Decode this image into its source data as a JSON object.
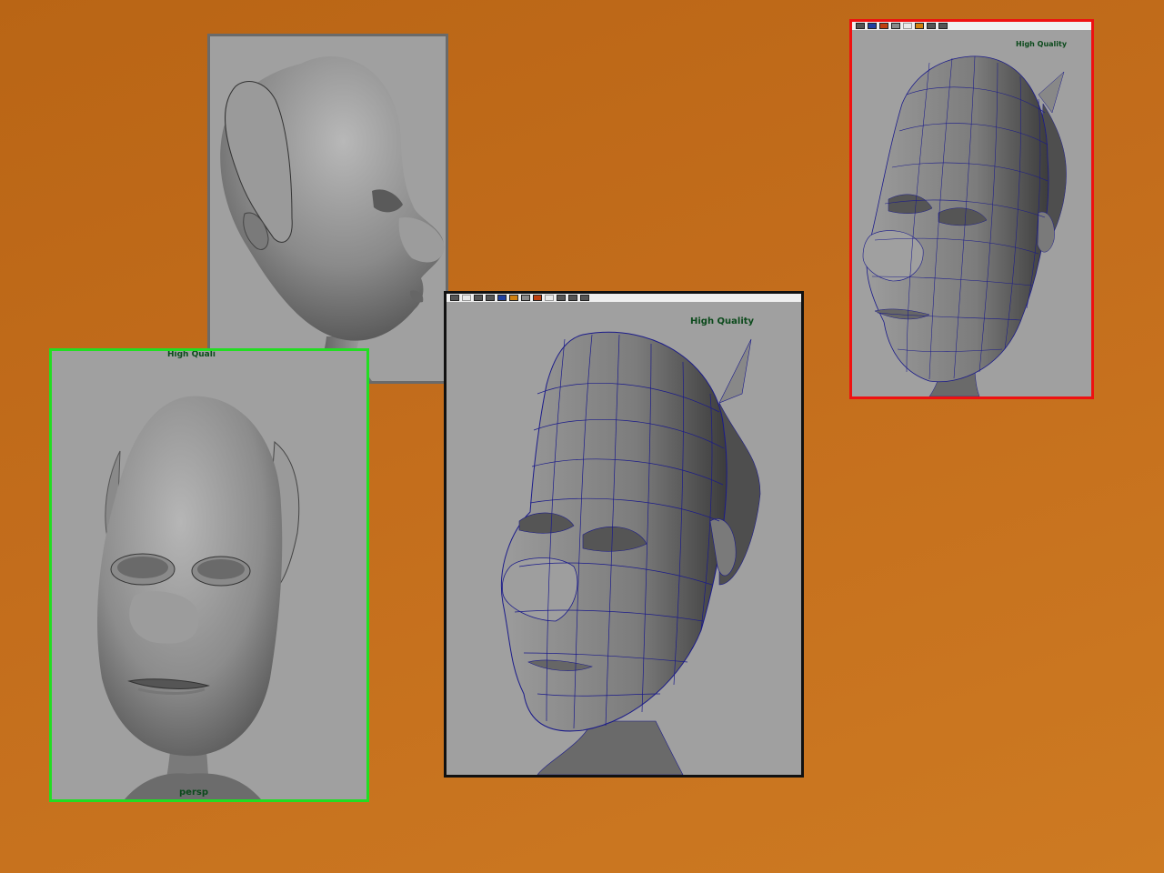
{
  "background_color": "#c36d1c",
  "viewports": [
    {
      "id": "side-view",
      "border_color": "#6a6a6a",
      "style": "smooth-shaded",
      "view": "side profile"
    },
    {
      "id": "front-view",
      "border_color": "#22dd22",
      "style": "smooth-shaded",
      "view": "front",
      "hud_label": "High Quali",
      "camera_label": "persp"
    },
    {
      "id": "wire-center",
      "border_color": "#111111",
      "style": "wireframe-on-shaded",
      "view": "three-quarter",
      "hud_label": "High Quality"
    },
    {
      "id": "wire-right",
      "border_color": "#ee1111",
      "style": "wireframe-on-shaded",
      "view": "three-quarter",
      "hud_label": "High Quality"
    }
  ],
  "wireframe_color": "#1b1b8a",
  "viewport_bg": "#a0a0a0",
  "toolbar_icons": [
    "grid-icon",
    "shaded-icon",
    "wireframe-icon",
    "texture-icon",
    "light-icon",
    "camera-icon",
    "isolate-icon",
    "xray-icon",
    "hq-icon"
  ]
}
